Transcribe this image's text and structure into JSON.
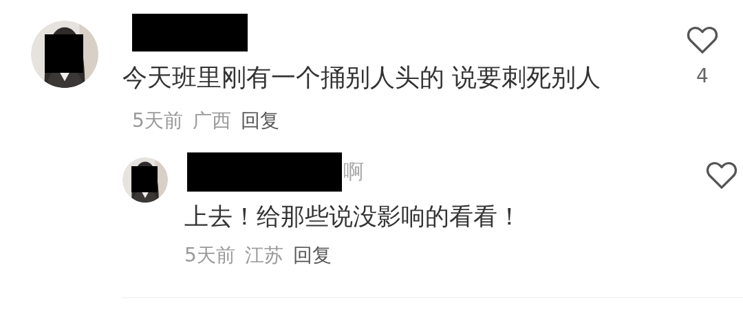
{
  "comment": {
    "avatar": {
      "kind": "picture",
      "redacted": true
    },
    "name_redacted": true,
    "text": "今天班里刚有一个捅别人头的 说要刺死别人",
    "time": "5天前",
    "location": "广西",
    "reply_label": "回复",
    "liked": false,
    "like_count": "4"
  },
  "replies": [
    {
      "avatar": {
        "kind": "picture",
        "redacted": true
      },
      "name_redacted": true,
      "name_tail": "啊",
      "text": "上去！给那些说没影响的看看！",
      "time": "5天前",
      "location": "江苏",
      "reply_label": "回复",
      "liked": false
    }
  ]
}
